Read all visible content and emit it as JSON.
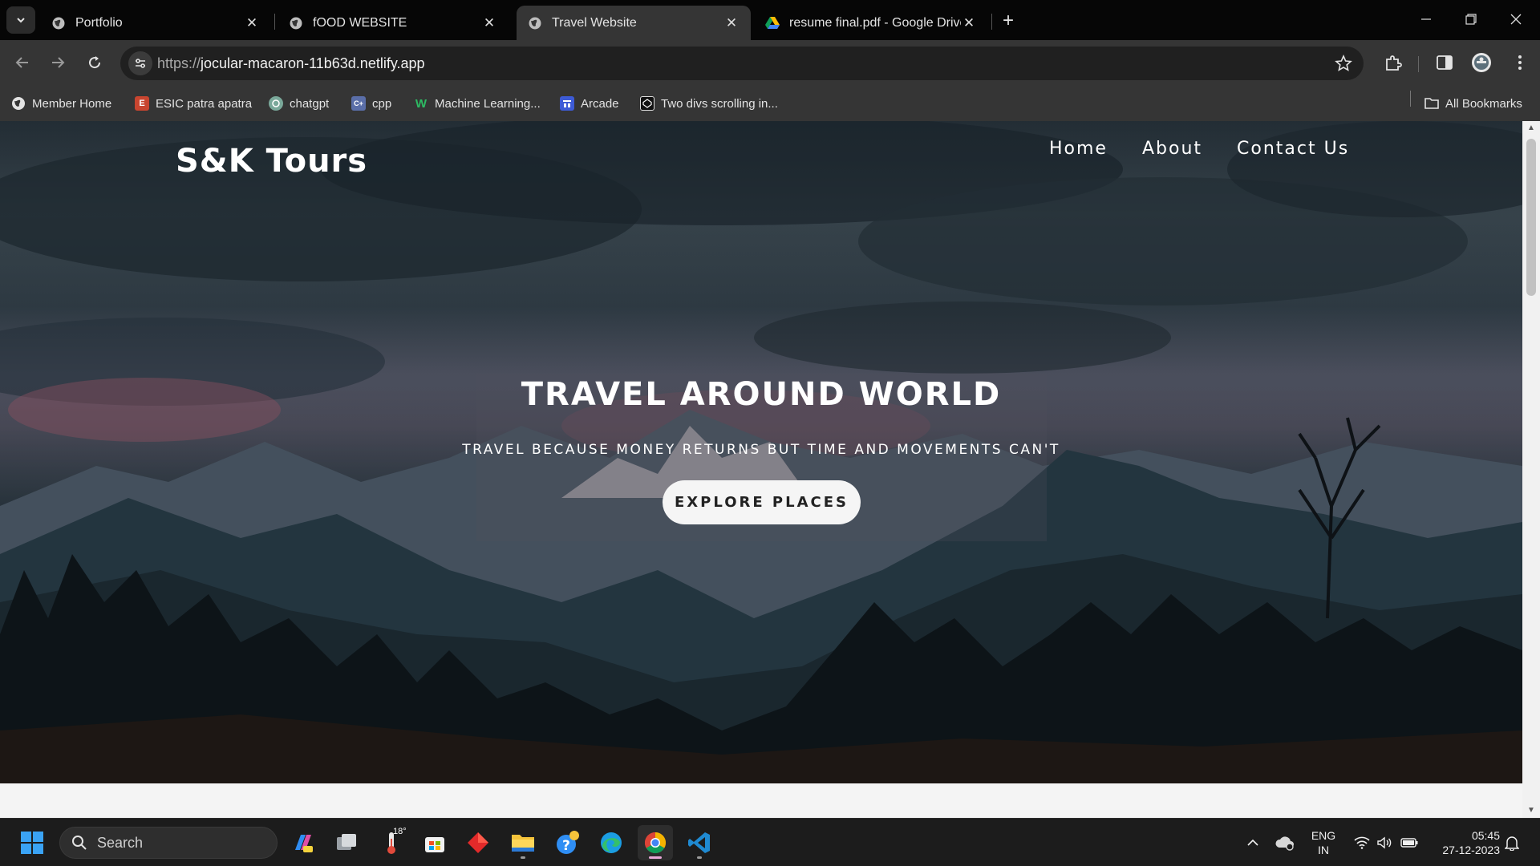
{
  "browser": {
    "tabs": [
      {
        "title": "Portfolio",
        "active": false
      },
      {
        "title": "fOOD WEBSITE",
        "active": false
      },
      {
        "title": "Travel Website",
        "active": true
      },
      {
        "title": "resume final.pdf - Google Drive",
        "active": false
      }
    ],
    "url": {
      "scheme": "https://",
      "host": "jocular-macaron-11b63d.netlify.app"
    },
    "bookmarks": [
      {
        "label": "Member Home",
        "icon": "globe-icon"
      },
      {
        "label": "ESIC patra apatra",
        "icon": "esic-icon"
      },
      {
        "label": "chatgpt",
        "icon": "chatgpt-icon"
      },
      {
        "label": "cpp",
        "icon": "cpp-icon"
      },
      {
        "label": "Machine Learning...",
        "icon": "w-icon"
      },
      {
        "label": "Arcade",
        "icon": "arcade-icon"
      },
      {
        "label": "Two divs scrolling in...",
        "icon": "codepen-icon"
      }
    ],
    "all_bookmarks": "All Bookmarks"
  },
  "site": {
    "logo": "S&K Tours",
    "nav": [
      "Home",
      "About",
      "Contact Us"
    ],
    "hero": {
      "title": "TRAVEL AROUND WORLD",
      "subtitle": "TRAVEL BECAUSE MONEY RETURNS BUT TIME AND MOVEMENTS CAN'T",
      "cta": "EXPLORE PLACES"
    }
  },
  "taskbar": {
    "search_placeholder": "Search",
    "weather_temp": "18°",
    "language": "ENG",
    "region": "IN",
    "time": "05:45",
    "date": "27-12-2023"
  },
  "colors": {
    "tab_strip": "#060606",
    "toolbar": "#353535",
    "omnibox": "#202020",
    "taskbar": "#1c1c1c",
    "cta_bg": "#f5f5f5"
  }
}
